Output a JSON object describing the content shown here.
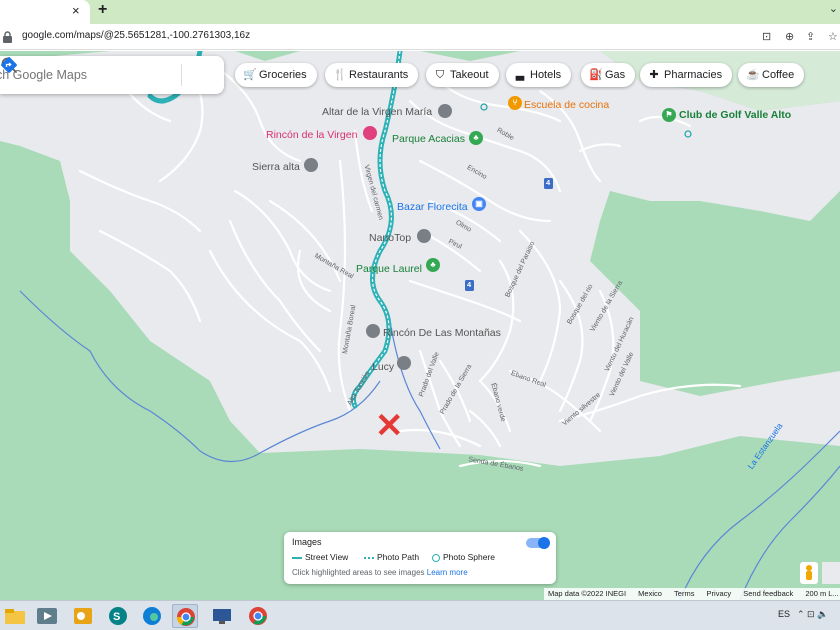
{
  "browser": {
    "tab_close": "×",
    "new_tab": "+",
    "url": "google.com/maps/@25.5651281,-100.2761303,16z"
  },
  "search": {
    "placeholder": "ch Google Maps"
  },
  "chips": [
    {
      "label": "Groceries",
      "icon": "cart-icon"
    },
    {
      "label": "Restaurants",
      "icon": "fork-knife-icon"
    },
    {
      "label": "Takeout",
      "icon": "takeout-bag-icon"
    },
    {
      "label": "Hotels",
      "icon": "bed-icon"
    },
    {
      "label": "Gas",
      "icon": "fuel-pump-icon"
    },
    {
      "label": "Pharmacies",
      "icon": "pharmacy-icon"
    },
    {
      "label": "Coffee",
      "icon": "coffee-cup-icon"
    }
  ],
  "places": {
    "altar": "Altar de la Virgen María",
    "escuela": "Escuela de cocina",
    "golf": "Club de Golf Valle Alto",
    "rincon_virgen": "Rincón de la Virgen",
    "parque_acacias": "Parque Acacias",
    "sierra_alta": "Sierra alta",
    "bazar": "Bazar Florecita",
    "nanotop": "NanoTop",
    "parque_laurel": "Parque Laurel",
    "rincon_montanas": "Rincón De Las Montañas",
    "lucy": "Lucy"
  },
  "streets": {
    "roble": "Roble",
    "encino": "Encino",
    "olmo": "Olmo",
    "pirul": "Pirul",
    "virgen_carmen": "Virgen del carmen",
    "montana_real": "Montaña Real",
    "montana_boreal": "Montaña Boreal",
    "bosque_paraiso": "Bosque del Paraiso",
    "bosque_rio": "Bosque del rio",
    "viento_sierra": "Viento de la Sierra",
    "viento_huracan": "Viento del Huracán",
    "viento_valle": "Viento del Valle",
    "prado_valle": "Prado del Valle",
    "prado_sierra": "Prado de la Sierra",
    "ebano_real": "Ebano Real",
    "ebano_verde": "Ébano verde",
    "viento_silvestre": "Viento silvestre",
    "senda_ebanos": "Senda de Ébanos",
    "la_estanzuela": "La Estanzuela",
    "alta_tension": "Alta Tensión",
    "shield_4a": "4",
    "shield_4b": "4"
  },
  "marker": "✕",
  "images_card": {
    "title": "Images",
    "street_view": "Street View",
    "photo_path": "Photo Path",
    "photo_sphere": "Photo Sphere",
    "hint": "Click highlighted areas to see images",
    "learn_more": "Learn more"
  },
  "footer": {
    "map_data": "Map data ©2022 INEGI",
    "mexico": "Mexico",
    "terms": "Terms",
    "privacy": "Privacy",
    "feedback": "Send feedback",
    "scale": "200 m L..."
  },
  "taskbar": {
    "lang": "ES",
    "tray": "⌃ ⊡ 🔈"
  },
  "colors": {
    "park_green": "#a9dbb8",
    "urban_gray": "#e8eaed",
    "river_teal": "#2bb1b6",
    "accent_blue": "#1a73e8",
    "marker_red": "#e53935"
  }
}
